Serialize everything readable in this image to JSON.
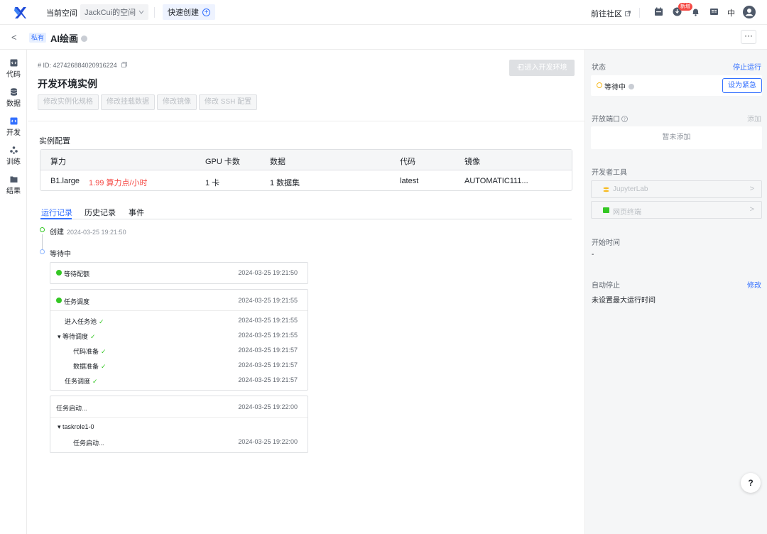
{
  "topbar": {
    "space_label": "当前空间",
    "space_name": "JackCui的空间",
    "quick_create": "快速创建",
    "community": "前往社区",
    "badge": "新增",
    "lang": "中"
  },
  "subbar": {
    "private_tag": "私有",
    "title": "AI绘画",
    "more": "···"
  },
  "leftnav": {
    "items": [
      {
        "label": "代码",
        "icon": "code-icon"
      },
      {
        "label": "数据",
        "icon": "database-icon"
      },
      {
        "label": "开发",
        "icon": "develop-icon"
      },
      {
        "label": "训练",
        "icon": "train-icon"
      },
      {
        "label": "结果",
        "icon": "result-icon"
      }
    ],
    "active_index": 2
  },
  "main": {
    "id_line": "# ID: 427426884020916224",
    "title": "开发环境实例",
    "enter_button": "进入开发环境",
    "buttons": [
      "修改实例化规格",
      "修改挂载数据",
      "修改镜像",
      "修改 SSH 配置"
    ],
    "config_title": "实例配置",
    "table": {
      "headers": [
        "算力",
        "GPU 卡数",
        "数据",
        "代码",
        "镜像"
      ],
      "row": {
        "compute": "B1.large",
        "price": "1.99 算力点/小时",
        "gpu": "1 卡",
        "data": "1 数据集",
        "code": "latest",
        "image": "AUTOMATIC111..."
      }
    },
    "tabs": [
      "运行记录",
      "历史记录",
      "事件"
    ],
    "active_tab": 0,
    "timeline": {
      "created_label": "创建",
      "created_time": "2024-03-25 19:21:50",
      "waiting_label": "等待中"
    },
    "stages": {
      "quota": {
        "label": "等待配额",
        "time": "2024-03-25 19:21:50"
      },
      "schedule": {
        "label": "任务调度",
        "time": "2024-03-25 19:21:55",
        "items": [
          {
            "label": "进入任务池",
            "time": "2024-03-25 19:21:55"
          },
          {
            "label": "▾ 等待调度",
            "time": "2024-03-25 19:21:55"
          },
          {
            "label": "代码准备",
            "time": "2024-03-25 19:21:57"
          },
          {
            "label": "数据准备",
            "time": "2024-03-25 19:21:57"
          },
          {
            "label": "任务调度",
            "time": "2024-03-25 19:21:57"
          }
        ]
      },
      "start": {
        "label": "任务启动...",
        "time": "2024-03-25 19:22:00",
        "role": "▾ taskrole1-0",
        "sub_label": "任务启动...",
        "sub_time": "2024-03-25 19:22:00"
      }
    }
  },
  "right": {
    "status_label": "状态",
    "stop_link": "停止运行",
    "status_value": "等待中",
    "urgent_button": "设为紧急",
    "ports_label": "开放端口",
    "ports_add": "添加",
    "ports_empty": "暂未添加",
    "tools_label": "开发者工具",
    "tools": [
      "JupyterLab",
      "网页终端"
    ],
    "start_time_label": "开始时间",
    "start_time_value": "-",
    "auto_stop_label": "自动停止",
    "auto_stop_edit": "修改",
    "auto_stop_value": "未设置最大运行时间"
  },
  "help": "?"
}
